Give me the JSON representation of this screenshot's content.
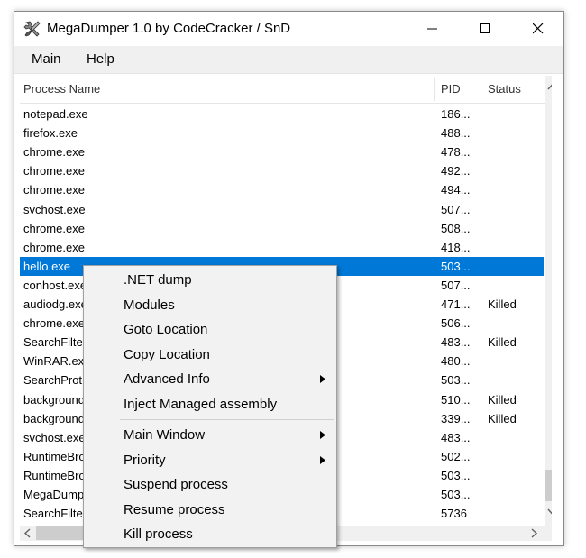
{
  "window": {
    "title": "MegaDumper 1.0 by CodeCracker / SnD"
  },
  "menubar": {
    "items": [
      "Main",
      "Help"
    ]
  },
  "list": {
    "columns": [
      "Process Name",
      "PID",
      "Status"
    ],
    "rows": [
      {
        "name": "notepad.exe",
        "pid": "186...",
        "status": ""
      },
      {
        "name": "firefox.exe",
        "pid": "488...",
        "status": ""
      },
      {
        "name": "chrome.exe",
        "pid": "478...",
        "status": ""
      },
      {
        "name": "chrome.exe",
        "pid": "492...",
        "status": ""
      },
      {
        "name": "chrome.exe",
        "pid": "494...",
        "status": ""
      },
      {
        "name": "svchost.exe",
        "pid": "507...",
        "status": ""
      },
      {
        "name": "chrome.exe",
        "pid": "508...",
        "status": ""
      },
      {
        "name": "chrome.exe",
        "pid": "418...",
        "status": ""
      },
      {
        "name": "hello.exe",
        "pid": "503...",
        "status": "",
        "selected": true
      },
      {
        "name": "conhost.exe",
        "pid": "507...",
        "status": ""
      },
      {
        "name": "audiodg.exe",
        "pid": "471...",
        "status": "Killed"
      },
      {
        "name": "chrome.exe",
        "pid": "506...",
        "status": ""
      },
      {
        "name": "SearchFilte",
        "pid": "483...",
        "status": "Killed"
      },
      {
        "name": "WinRAR.ex",
        "pid": "480...",
        "status": ""
      },
      {
        "name": "SearchProt",
        "pid": "503...",
        "status": ""
      },
      {
        "name": "background",
        "pid": "510...",
        "status": "Killed"
      },
      {
        "name": "background",
        "pid": "339...",
        "status": "Killed"
      },
      {
        "name": "svchost.exe",
        "pid": "483...",
        "status": ""
      },
      {
        "name": "RuntimeBro",
        "pid": "502...",
        "status": ""
      },
      {
        "name": "RuntimeBro",
        "pid": "503...",
        "status": ""
      },
      {
        "name": "MegaDump",
        "pid": "503...",
        "status": ""
      },
      {
        "name": "SearchFilte",
        "pid": "5736",
        "status": ""
      }
    ]
  },
  "context_menu": {
    "group1": [
      {
        "label": ".NET dump",
        "submenu": false
      },
      {
        "label": "Modules",
        "submenu": false
      },
      {
        "label": "Goto Location",
        "submenu": false
      },
      {
        "label": "Copy Location",
        "submenu": false
      },
      {
        "label": "Advanced Info",
        "submenu": true
      },
      {
        "label": "Inject Managed assembly",
        "submenu": false
      }
    ],
    "group2": [
      {
        "label": "Main Window",
        "submenu": true
      },
      {
        "label": "Priority",
        "submenu": true
      },
      {
        "label": "Suspend process",
        "submenu": false
      },
      {
        "label": "Resume process",
        "submenu": false
      },
      {
        "label": "Kill process",
        "submenu": false
      }
    ]
  },
  "colors": {
    "selection": "#0078d7",
    "menubar": "#f0f0f0"
  }
}
